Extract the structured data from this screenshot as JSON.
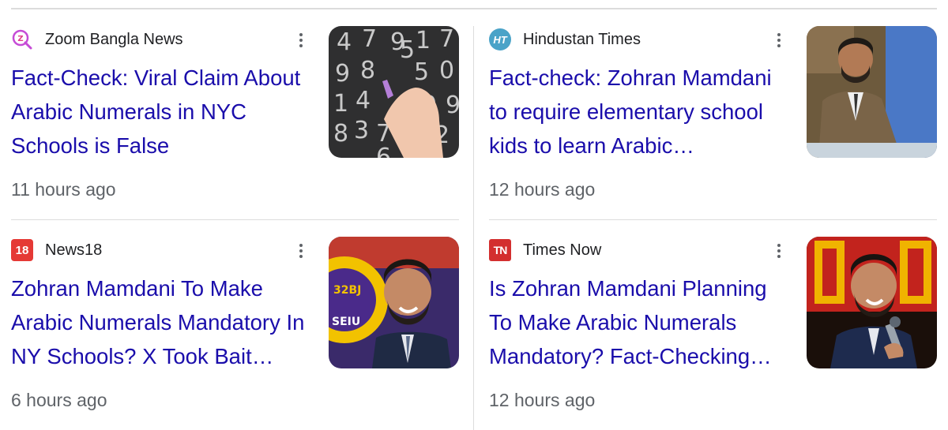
{
  "cards": [
    {
      "source": "Zoom Bangla News",
      "source_icon": "zoom-bangla-logo",
      "headline": "Fact-Check: Viral Claim About Arabic Numerals in NYC Schools is False",
      "time": "11 hours ago",
      "thumbnail": "chalkboard-numbers-image",
      "thumb_digits": [
        "4",
        "7",
        "9",
        "1",
        "7",
        "9",
        "8",
        "5",
        "0",
        "1",
        "4",
        "0",
        "8",
        "3",
        "7",
        "2",
        "9",
        "5",
        "6"
      ]
    },
    {
      "source": "Hindustan Times",
      "source_icon": "ht-logo",
      "source_icon_text": "HT",
      "headline": "Fact-check: Zohran Mamdani to require elementary school kids to learn Arabic…",
      "time": "12 hours ago",
      "thumbnail": "man-at-event-image"
    },
    {
      "source": "News18",
      "source_icon": "news18-logo",
      "source_icon_text": "18",
      "headline": "Zohran Mamdani To Make Arabic Numerals Mandatory In NY Schools? X Took Bait…",
      "time": "6 hours ago",
      "thumbnail": "smiling-man-rally-image",
      "thumb_sign_text": "32BJ SEIU"
    },
    {
      "source": "Times Now",
      "source_icon": "times-now-logo",
      "source_icon_text": "TN",
      "headline": "Is Zohran Mamdani Planning To Make Arabic Numerals Mandatory? Fact-Checking…",
      "time": "12 hours ago",
      "thumbnail": "man-with-microphone-image"
    }
  ],
  "menu_icon": "more-vert-icon",
  "colors": {
    "headline_link": "#1a0dab",
    "source_text": "#202124",
    "time_text": "#5f6368",
    "divider": "#dcdcdc",
    "news18_red": "#e53935",
    "times_now_red": "#d32f2f",
    "ht_teal": "#4aa3c8"
  }
}
